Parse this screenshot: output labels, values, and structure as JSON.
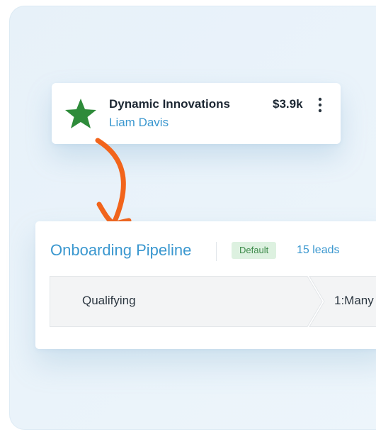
{
  "lead_card": {
    "company": "Dynamic Innovations",
    "contact": "Liam Davis",
    "value": "$3.9k",
    "star_icon": "star-icon",
    "menu_icon": "kebab-menu-icon"
  },
  "pipeline": {
    "title": "Onboarding Pipeline",
    "badge": "Default",
    "leads": "15 leads",
    "stages": [
      {
        "label": "Qualifying"
      },
      {
        "label": "1:Many"
      }
    ]
  },
  "colors": {
    "background": "#e9f2f9",
    "star": "#2e8b3a",
    "arrow": "#f2641b",
    "link": "#3a97cf",
    "badge_text": "#3d8a4a",
    "badge_bg": "#ddf1e0",
    "stage_bg": "#f3f4f5"
  }
}
